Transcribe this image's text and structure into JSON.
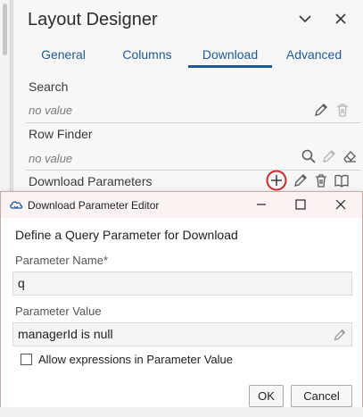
{
  "designer": {
    "title": "Layout Designer",
    "tabs": [
      {
        "label": "General"
      },
      {
        "label": "Columns"
      },
      {
        "label": "Download",
        "active": true
      },
      {
        "label": "Advanced"
      }
    ],
    "search": {
      "label": "Search",
      "value": "no value"
    },
    "row_finder": {
      "label": "Row Finder",
      "value": "no value"
    },
    "download_parameters": {
      "label": "Download Parameters"
    }
  },
  "dialog": {
    "title": "Download Parameter Editor",
    "heading": "Define a Query Parameter for Download",
    "parameter_name": {
      "label": "Parameter Name*",
      "value": "q"
    },
    "parameter_value": {
      "label": "Parameter Value",
      "value": "managerId is null"
    },
    "allow_expressions": {
      "label": "Allow expressions in Parameter Value",
      "checked": false
    },
    "ok_label": "OK",
    "cancel_label": "Cancel"
  },
  "colors": {
    "accent": "#1f5a99",
    "highlight_ring": "#d62828",
    "titlebar": "#fbf3f2"
  }
}
